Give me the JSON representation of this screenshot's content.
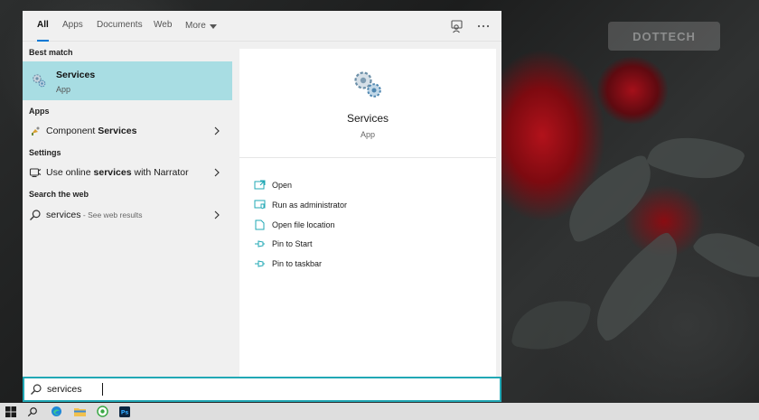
{
  "tabs": [
    {
      "label": "All",
      "active": true
    },
    {
      "label": "Apps",
      "active": false
    },
    {
      "label": "Documents",
      "active": false
    },
    {
      "label": "Web",
      "active": false
    },
    {
      "label": "More",
      "active": false
    }
  ],
  "header_icons": [
    "feedback-icon",
    "more-options-icon"
  ],
  "sections": {
    "best_match": "Best match",
    "apps": "Apps",
    "settings": "Settings",
    "search_web": "Search the web"
  },
  "best_match": {
    "title": "Services",
    "subtitle": "App",
    "icon": "services-gear-icon"
  },
  "apps": [
    {
      "prefix": "Component ",
      "bold": "Services",
      "suffix": "",
      "icon": "component-services-icon"
    }
  ],
  "settings": [
    {
      "prefix": "Use online ",
      "bold": "services",
      "suffix": " with Narrator",
      "icon": "narrator-icon"
    }
  ],
  "web": [
    {
      "query": "services",
      "sub": " - See web results",
      "icon": "search-icon"
    }
  ],
  "details": {
    "title": "Services",
    "type": "App",
    "actions": [
      {
        "label": "Open",
        "icon": "open-icon"
      },
      {
        "label": "Run as administrator",
        "icon": "shield-icon"
      },
      {
        "label": "Open file location",
        "icon": "file-location-icon"
      },
      {
        "label": "Pin to Start",
        "icon": "pin-icon"
      },
      {
        "label": "Pin to taskbar",
        "icon": "pin-icon"
      }
    ]
  },
  "search": {
    "value": "services"
  },
  "colors": {
    "accent": "#21a8b5",
    "selection": "#a8dde3",
    "tab_underline": "#0078d4"
  },
  "taskbar": [
    "windows-start-icon",
    "search-icon",
    "edge-icon",
    "file-explorer-icon",
    "green-app-icon",
    "photoshop-icon"
  ],
  "watermark": "DOTTECH"
}
